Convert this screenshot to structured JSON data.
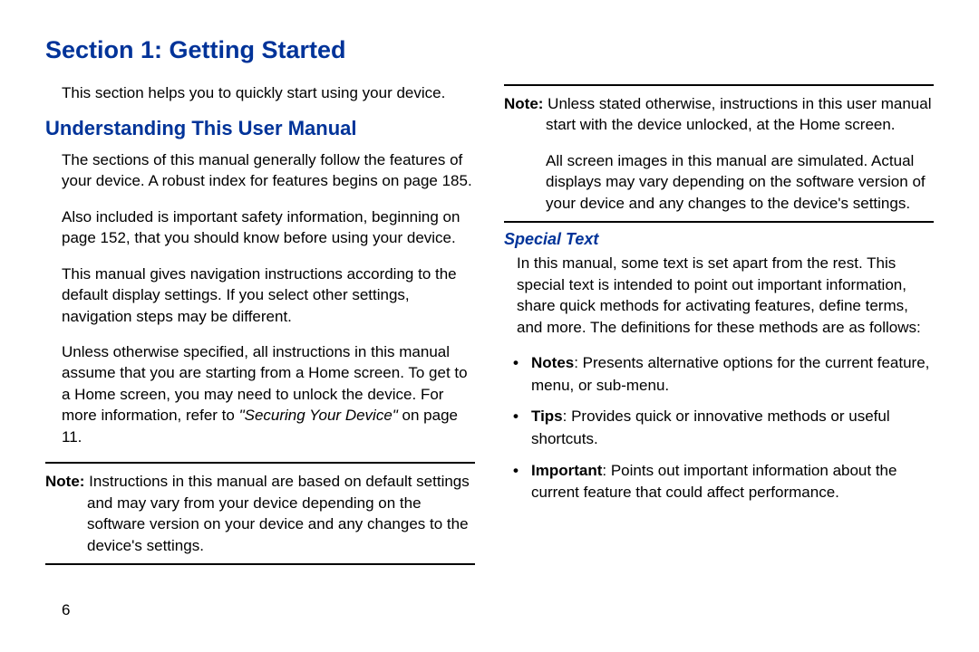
{
  "heading": "Section 1: Getting Started",
  "pageNumber": "6",
  "left": {
    "intro": "This section helps you to quickly start using your device.",
    "h2": "Understanding This User Manual",
    "p1": "The sections of this manual generally follow the features of your device. A robust index for features begins on page 185.",
    "p2": "Also included is important safety information, beginning on page 152, that you should know before using your device.",
    "p3": "This manual gives navigation instructions according to the default display settings. If you select other settings, navigation steps may be different.",
    "p4_pre": "Unless otherwise specified, all instructions in this manual assume that you are starting from a Home screen. To get to a Home screen, you may need to unlock the device. For more information, refer to ",
    "p4_italic": "\"Securing Your Device\"",
    "p4_post": " on page 11.",
    "noteLabel": "Note: ",
    "note1": "Instructions in this manual are based on default settings and may vary from your device depending on the software version on your device and any changes to the device's settings."
  },
  "right": {
    "noteLabel": "Note: ",
    "note2_a": "Unless stated otherwise, instructions in this user manual start with the device unlocked, at the Home screen.",
    "note2_b": "All screen images in this manual are simulated. Actual displays may vary depending on the software version of your device and any changes to the device's settings.",
    "h3": "Special Text",
    "p5": "In this manual, some text is set apart from the rest. This special text is intended to point out important information, share quick methods for activating features, define terms, and more. The definitions for these methods are as follows:",
    "bullets": [
      {
        "term": "Notes",
        "text": ": Presents alternative options for the current feature, menu, or sub-menu."
      },
      {
        "term": "Tips",
        "text": ": Provides quick or innovative methods or useful shortcuts."
      },
      {
        "term": "Important",
        "text": ": Points out important information about the current feature that could affect performance."
      }
    ]
  }
}
